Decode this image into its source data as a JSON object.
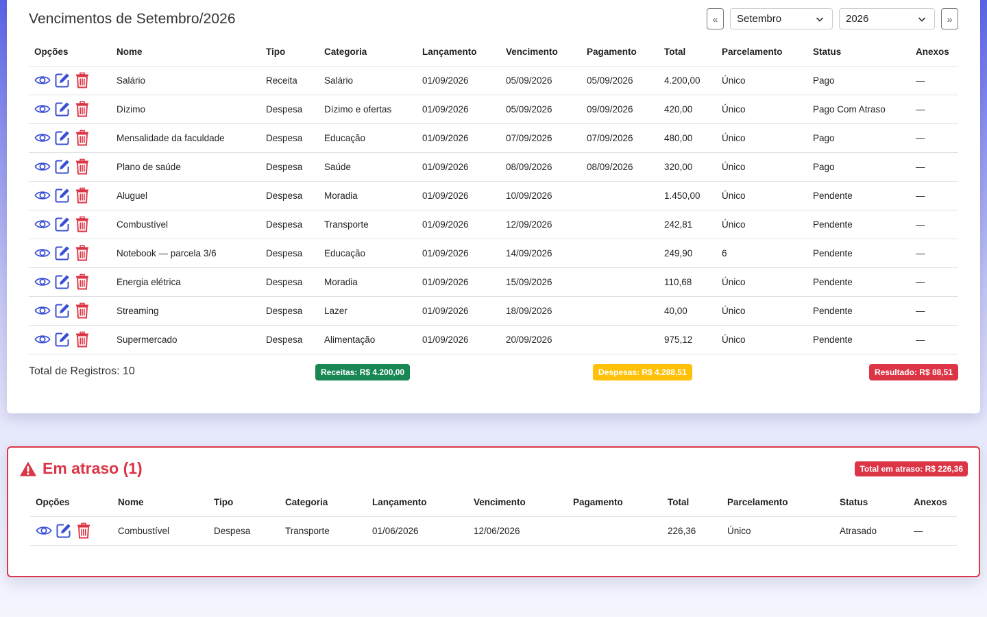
{
  "header": {
    "title": "Vencimentos de Setembro/2026",
    "prev_label": "«",
    "next_label": "»",
    "month_selected": "Setembro",
    "year_selected": "2026"
  },
  "columns": [
    "Opções",
    "Nome",
    "Tipo",
    "Categoria",
    "Lançamento",
    "Vencimento",
    "Pagamento",
    "Total",
    "Parcelamento",
    "Status",
    "Anexos"
  ],
  "rows": [
    {
      "nome": "Salário",
      "tipo": "Receita",
      "categoria": "Salário",
      "lancamento": "01/09/2026",
      "vencimento": "05/09/2026",
      "pagamento": "05/09/2026",
      "total": "4.200,00",
      "parcelamento": "Único",
      "status": "Pago",
      "anexos": "—"
    },
    {
      "nome": "Dízimo",
      "tipo": "Despesa",
      "categoria": "Dízimo e ofertas",
      "lancamento": "01/09/2026",
      "vencimento": "05/09/2026",
      "pagamento": "09/09/2026",
      "total": "420,00",
      "parcelamento": "Único",
      "status": "Pago Com Atraso",
      "anexos": "—"
    },
    {
      "nome": "Mensalidade da faculdade",
      "tipo": "Despesa",
      "categoria": "Educação",
      "lancamento": "01/09/2026",
      "vencimento": "07/09/2026",
      "pagamento": "07/09/2026",
      "total": "480,00",
      "parcelamento": "Único",
      "status": "Pago",
      "anexos": "—"
    },
    {
      "nome": "Plano de saúde",
      "tipo": "Despesa",
      "categoria": "Saúde",
      "lancamento": "01/09/2026",
      "vencimento": "08/09/2026",
      "pagamento": "08/09/2026",
      "total": "320,00",
      "parcelamento": "Único",
      "status": "Pago",
      "anexos": "—"
    },
    {
      "nome": "Aluguel",
      "tipo": "Despesa",
      "categoria": "Moradia",
      "lancamento": "01/09/2026",
      "vencimento": "10/09/2026",
      "pagamento": "",
      "total": "1.450,00",
      "parcelamento": "Único",
      "status": "Pendente",
      "anexos": "—"
    },
    {
      "nome": "Combustível",
      "tipo": "Despesa",
      "categoria": "Transporte",
      "lancamento": "01/09/2026",
      "vencimento": "12/09/2026",
      "pagamento": "",
      "total": "242,81",
      "parcelamento": "Único",
      "status": "Pendente",
      "anexos": "—"
    },
    {
      "nome": "Notebook — parcela 3/6",
      "tipo": "Despesa",
      "categoria": "Educação",
      "lancamento": "01/09/2026",
      "vencimento": "14/09/2026",
      "pagamento": "",
      "total": "249,90",
      "parcelamento": "6",
      "status": "Pendente",
      "anexos": "—"
    },
    {
      "nome": "Energia elétrica",
      "tipo": "Despesa",
      "categoria": "Moradia",
      "lancamento": "01/09/2026",
      "vencimento": "15/09/2026",
      "pagamento": "",
      "total": "110,68",
      "parcelamento": "Único",
      "status": "Pendente",
      "anexos": "—"
    },
    {
      "nome": "Streaming",
      "tipo": "Despesa",
      "categoria": "Lazer",
      "lancamento": "01/09/2026",
      "vencimento": "18/09/2026",
      "pagamento": "",
      "total": "40,00",
      "parcelamento": "Único",
      "status": "Pendente",
      "anexos": "—"
    },
    {
      "nome": "Supermercado",
      "tipo": "Despesa",
      "categoria": "Alimentação",
      "lancamento": "01/09/2026",
      "vencimento": "20/09/2026",
      "pagamento": "",
      "total": "975,12",
      "parcelamento": "Único",
      "status": "Pendente",
      "anexos": "—"
    }
  ],
  "summary": {
    "total_records": "Total de Registros: 10",
    "receitas": "Receitas: R$ 4.200,00",
    "despesas": "Despesas: R$ 4.288,51",
    "resultado": "Resultado: R$ 88,51"
  },
  "late": {
    "title": "Em atraso (1)",
    "total": "Total em atraso: R$ 226,36",
    "rows": [
      {
        "nome": "Combustível",
        "tipo": "Despesa",
        "categoria": "Transporte",
        "lancamento": "01/06/2026",
        "vencimento": "12/06/2026",
        "pagamento": "",
        "total": "226,36",
        "parcelamento": "Único",
        "status": "Atrasado",
        "anexos": "—"
      }
    ]
  },
  "icons": [
    "eye-icon",
    "edit-icon",
    "trash-icon",
    "chevron-down-icon",
    "warning-icon"
  ],
  "colors": {
    "icon_blue": "#3b4fd6",
    "delete_red": "#dc3545",
    "receitas_green": "#198754",
    "despesas_yellow": "#ffc107",
    "danger_red": "#dc3545"
  }
}
